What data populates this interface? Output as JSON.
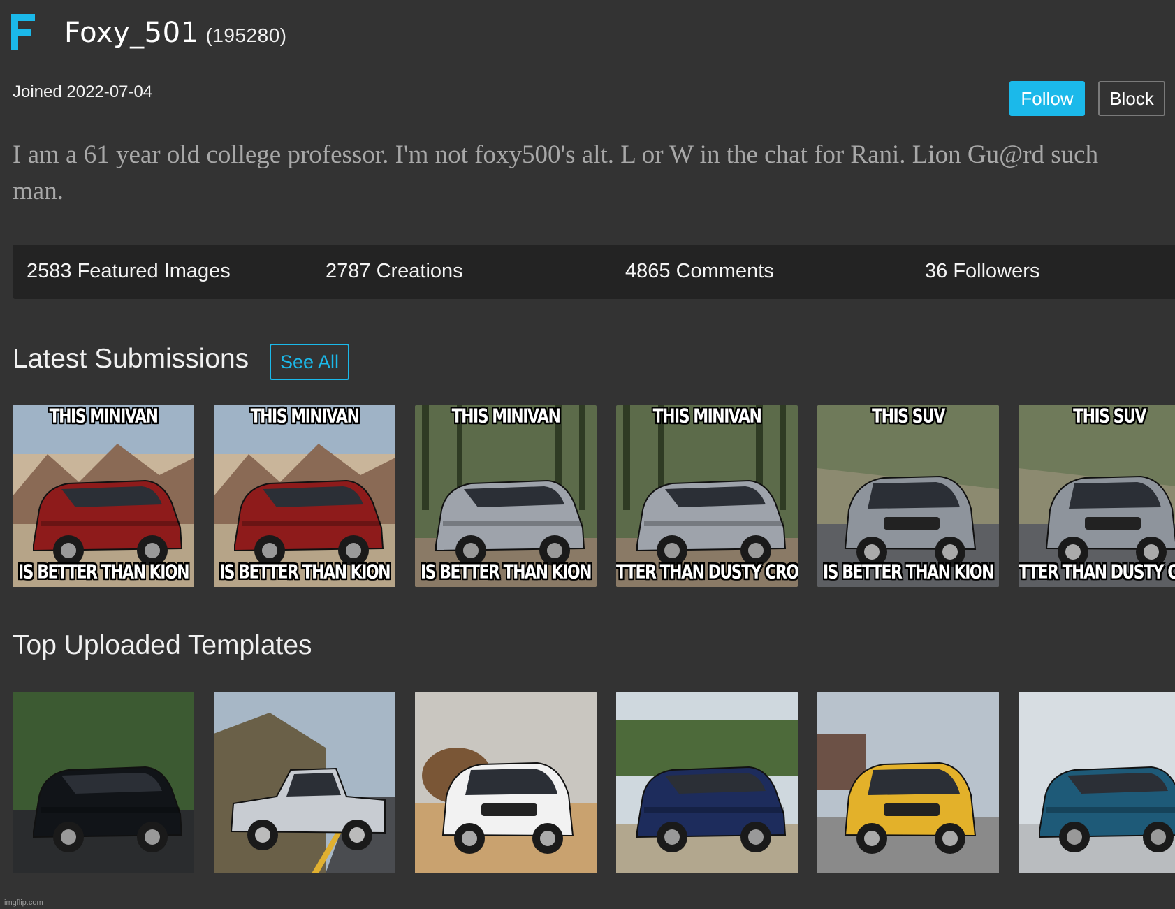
{
  "header": {
    "logo_letter": "F",
    "username": "Foxy_501",
    "points": "(195280)",
    "joined": "Joined 2022-07-04",
    "follow_label": "Follow",
    "block_label": "Block",
    "accent": "#1bb9ea"
  },
  "bio": {
    "line1": "I am a 61 year old college professor. I'm not foxy500's alt. L or W in the chat for Rani. Lion Gu@rd such",
    "line2": "man."
  },
  "stats": [
    {
      "label": "2583 Featured Images"
    },
    {
      "label": "2787 Creations"
    },
    {
      "label": "4865 Comments"
    },
    {
      "label": "36 Followers"
    }
  ],
  "latest": {
    "title": "Latest Submissions",
    "see_all": "See All",
    "items": [
      {
        "top": "THIS MINIVAN",
        "bottom": "IS BETTER THAN KION",
        "scene": "red-minivan-desert"
      },
      {
        "top": "THIS MINIVAN",
        "bottom": "IS BETTER THAN KION",
        "scene": "red-minivan-desert"
      },
      {
        "top": "THIS MINIVAN",
        "bottom": "IS BETTER THAN KION",
        "scene": "silver-minivan-forest"
      },
      {
        "top": "THIS MINIVAN",
        "bottom": "TTER THAN DUSTY CROPHO",
        "scene": "silver-minivan-forest"
      },
      {
        "top": "THIS SUV",
        "bottom": "IS BETTER THAN KION",
        "scene": "silver-suv-road"
      },
      {
        "top": "THIS SUV",
        "bottom": "TTER THAN DUSTY CRO",
        "scene": "silver-suv-road"
      }
    ]
  },
  "templates": {
    "title": "Top Uploaded Templates",
    "items": [
      {
        "scene": "black-minivan-wet-road"
      },
      {
        "scene": "silver-pickup-coast-road"
      },
      {
        "scene": "white-suv-desert"
      },
      {
        "scene": "blue-minivan-trees"
      },
      {
        "scene": "yellow-suv-street"
      },
      {
        "scene": "teal-minivan"
      }
    ]
  },
  "footer": {
    "watermark": "imgflip.com"
  }
}
